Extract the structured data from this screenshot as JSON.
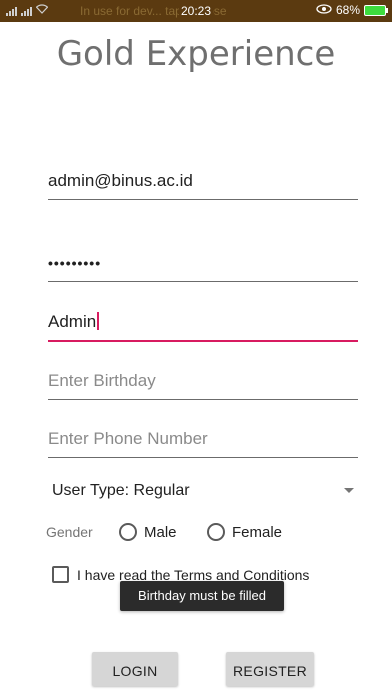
{
  "status_bar": {
    "background_notice": "In use for dev... tap to close",
    "time": "20:23",
    "battery_percent": "68%",
    "icons": [
      "signal-icon",
      "wifi-icon",
      "eye-icon",
      "battery-icon"
    ]
  },
  "app": {
    "title": "Gold Experience"
  },
  "form": {
    "email": {
      "value": "admin@binus.ac.id"
    },
    "password": {
      "value": "•••••••••"
    },
    "name": {
      "value": "Admin"
    },
    "birthday": {
      "value": "",
      "placeholder": "Enter Birthday"
    },
    "phone": {
      "value": "",
      "placeholder": "Enter Phone Number"
    },
    "user_type": {
      "selected": "User Type: Regular"
    },
    "gender": {
      "label": "Gender",
      "options": [
        "Male",
        "Female"
      ],
      "selected": ""
    },
    "terms": {
      "label": "I have read the Terms and Conditions",
      "checked": false
    }
  },
  "toast": {
    "message": "Birthday must be filled"
  },
  "buttons": {
    "login": "LOGIN",
    "register": "REGISTER"
  },
  "colors": {
    "status_bar": "#5b3a10",
    "accent": "#d81b60",
    "title": "#6f6f6f",
    "button_bg": "#d6d6d6",
    "toast_bg": "#2b2b2b"
  }
}
